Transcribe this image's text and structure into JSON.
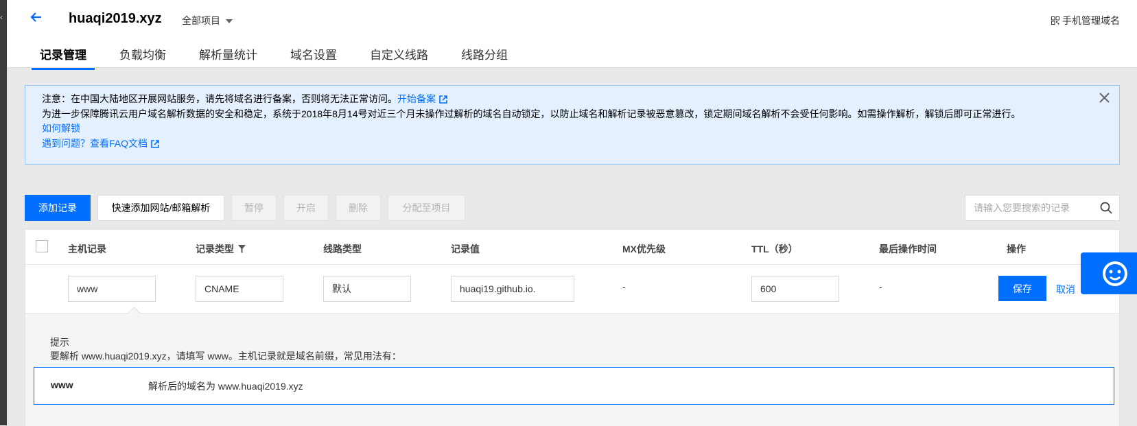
{
  "header": {
    "back_icon": "arrow-left-icon",
    "domain": "huaqi2019.xyz",
    "project_selector": "全部项目",
    "mobile_manage": "手机管理域名"
  },
  "tabs": [
    {
      "label": "记录管理",
      "active": true
    },
    {
      "label": "负载均衡"
    },
    {
      "label": "解析量统计"
    },
    {
      "label": "域名设置"
    },
    {
      "label": "自定义线路"
    },
    {
      "label": "线路分组"
    }
  ],
  "notice": {
    "line1": "注意：在中国大陆地区开展网站服务，请先将域名进行备案，否则将无法正常访问。",
    "line1_link": "开始备案",
    "line2": "为进一步保障腾讯云用户域名解析数据的安全和稳定，系统于2018年8月14号对近三个月未操作过解析的域名自动锁定，以防止域名和解析记录被恶意篡改，锁定期间域名解析不会受任何影响。如需操作解析，解锁后即可正常进行。",
    "line3_link": "如何解锁",
    "line4": "遇到问题？",
    "line4_link": "查看FAQ文档"
  },
  "toolbar": {
    "add_record": "添加记录",
    "quick_add": "快速添加网站/邮箱解析",
    "pause": "暂停",
    "enable": "开启",
    "delete": "删除",
    "assign_project": "分配至项目",
    "search_placeholder": "请输入您要搜索的记录"
  },
  "table": {
    "columns": [
      "主机记录",
      "记录类型",
      "线路类型",
      "记录值",
      "MX优先级",
      "TTL（秒）",
      "最后操作时间",
      "操作"
    ],
    "edit_row": {
      "host": "www",
      "type": "CNAME",
      "line": "默认",
      "value": "huaqi19.github.io.",
      "mx": "-",
      "ttl": "600",
      "last_modified": "-",
      "save": "保存",
      "cancel": "取消"
    }
  },
  "hint": {
    "title": "提示",
    "description": "要解析 www.huaqi2019.xyz，请填写 www。主机记录就是域名前缀，常见用法有：",
    "example_key": "www",
    "example_value": "解析后的域名为 www.huaqi2019.xyz"
  },
  "colors": {
    "primary": "#006eff",
    "notice_bg": "#e5f0ff",
    "page_bg": "#e9e9e9"
  }
}
